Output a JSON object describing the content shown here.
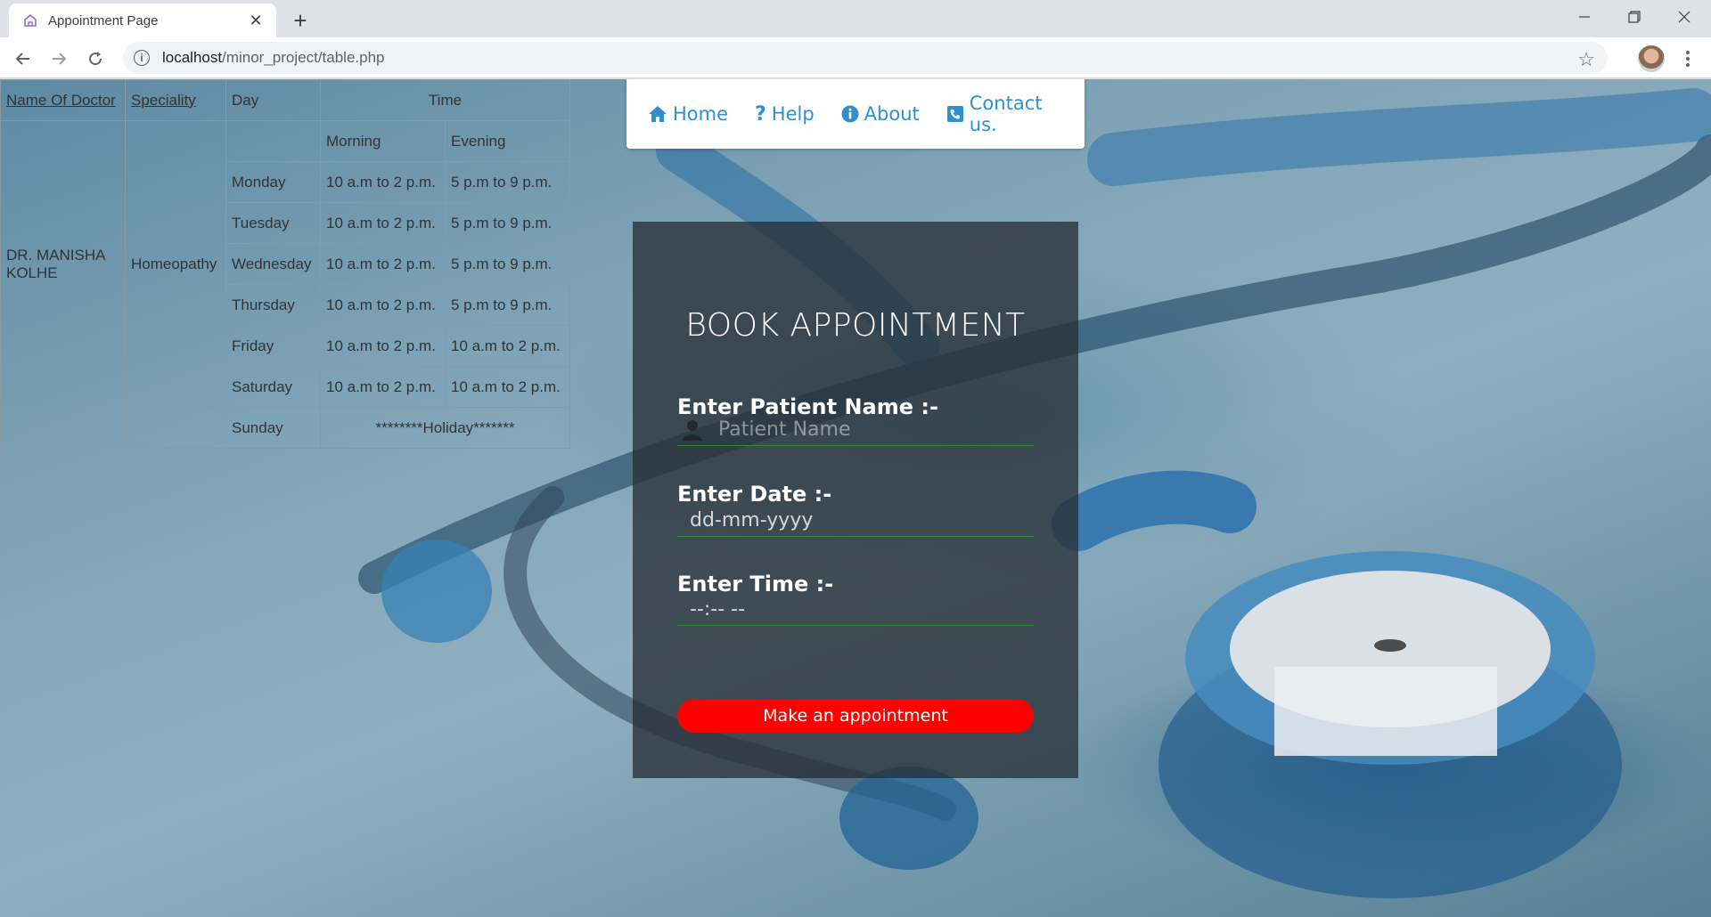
{
  "browser": {
    "tab_title": "Appointment Page",
    "url_host": "localhost",
    "url_path": "/minor_project/table.php",
    "new_tab_label": "+",
    "close_tab_label": "✕"
  },
  "schedule": {
    "headers": {
      "doctor": "Name Of Doctor",
      "speciality": "Speciality",
      "day": "Day",
      "time": "Time",
      "morning": "Morning",
      "evening": "Evening"
    },
    "doctor_name": "DR. MANISHA KOLHE",
    "speciality_value": "Homeopathy",
    "rows": [
      {
        "day": "Monday",
        "morning": "10 a.m to 2 p.m.",
        "evening": "5 p.m to 9 p.m."
      },
      {
        "day": "Tuesday",
        "morning": "10 a.m to 2 p.m.",
        "evening": "5 p.m to 9 p.m."
      },
      {
        "day": "Wednesday",
        "morning": "10 a.m to 2 p.m.",
        "evening": "5 p.m to 9 p.m."
      },
      {
        "day": "Thursday",
        "morning": "10 a.m to 2 p.m.",
        "evening": "5 p.m to 9 p.m."
      },
      {
        "day": "Friday",
        "morning": "10 a.m to 2 p.m.",
        "evening": "10 a.m to 2 p.m."
      },
      {
        "day": "Saturday",
        "morning": "10 a.m to 2 p.m.",
        "evening": "10 a.m to 2 p.m."
      }
    ],
    "sunday": {
      "day": "Sunday",
      "note": "********Holiday*******"
    }
  },
  "nav": {
    "home": "Home",
    "help": "Help",
    "about": "About",
    "contact": "Contact us."
  },
  "booking": {
    "title": "BOOK APPOINTMENT",
    "name_label": "Enter Patient Name :-",
    "name_placeholder": "Patient Name",
    "date_label": "Enter Date :-",
    "date_value": "dd-mm-yyyy",
    "time_label": "Enter Time :-",
    "time_value": "--:-- --",
    "submit_label": "Make an appointment"
  },
  "colors": {
    "nav_link": "#2f8fcf",
    "submit_bg": "#ff0000",
    "field_underline": "#2e8b2e"
  }
}
